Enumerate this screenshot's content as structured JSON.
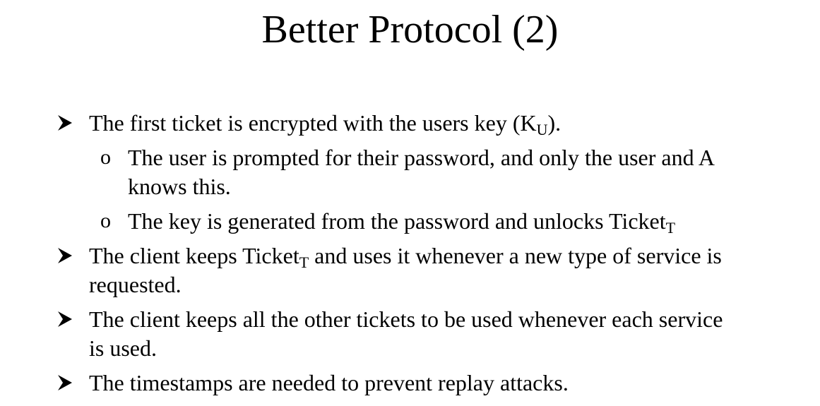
{
  "title": "Better Protocol (2)",
  "bullets": [
    {
      "text_before": "The first ticket is encrypted with the users key (K",
      "sub": "U",
      "text_after": ")."
    },
    {
      "line1": "The user is prompted for their password, and only the user and A",
      "line2": "knows this."
    },
    {
      "text_before": "The key is generated from the password and unlocks Ticket",
      "sub": "T"
    },
    {
      "text_before": "The client keeps Ticket",
      "sub": "T",
      "text_after": " and uses it whenever a new type of service is",
      "line2": "requested."
    },
    {
      "line1": "The client keeps all the other tickets to be used whenever each service",
      "line2": "is used."
    },
    {
      "line1": "The timestamps are needed to prevent replay attacks."
    }
  ],
  "sub_bullet_marker": "o"
}
